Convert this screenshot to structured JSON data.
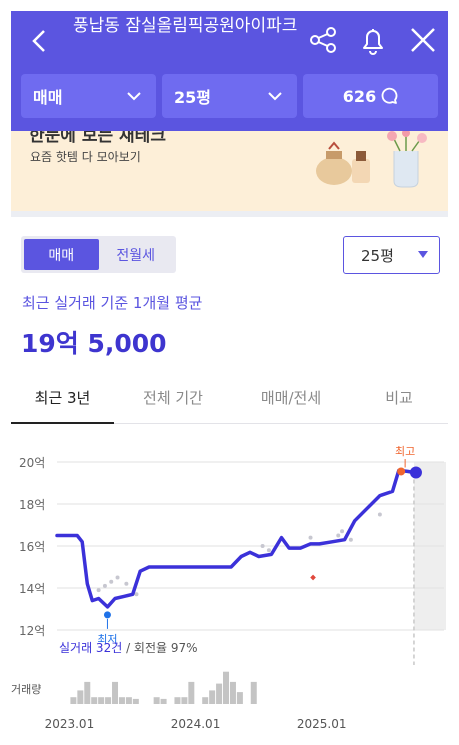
{
  "header": {
    "title": "풍납동 잠실올림픽공원아이파크",
    "filters": {
      "deal_type": "매매",
      "area": "25평",
      "comment_count": "626"
    },
    "bg_color": "#5b55e0"
  },
  "banner": {
    "headline": "한눈에 보는 재테크",
    "subtitle": "요즘 핫템 다 모아보기"
  },
  "segment": {
    "options": [
      "매매",
      "전월세"
    ],
    "selected": "매매"
  },
  "area_select": {
    "value": "25평"
  },
  "summary": {
    "label": "최근 실거래 기준 1개월 평균",
    "price": "19억 5,000"
  },
  "tabs": [
    {
      "label": "최근 3년",
      "active": true
    },
    {
      "label": "전체 기간",
      "active": false
    },
    {
      "label": "매매/전세",
      "active": false
    },
    {
      "label": "비교",
      "active": false
    }
  ],
  "chart_data": {
    "type": "line",
    "y_ticks": [
      "20억",
      "18억",
      "16억",
      "14억",
      "12억"
    ],
    "y_values": [
      20,
      18,
      16,
      14,
      12
    ],
    "ylim": [
      12,
      20
    ],
    "x_ticks": [
      "2023.01",
      "2024.01",
      "2025.01"
    ],
    "series": [
      {
        "values": [
          [
            2022.92,
            16.5
          ],
          [
            2023.0,
            16.5
          ],
          [
            2023.08,
            16.5
          ],
          [
            2023.12,
            16.2
          ],
          [
            2023.16,
            14.2
          ],
          [
            2023.2,
            13.4
          ],
          [
            2023.25,
            13.5
          ],
          [
            2023.32,
            13.1
          ],
          [
            2023.38,
            13.5
          ],
          [
            2023.45,
            13.6
          ],
          [
            2023.52,
            13.7
          ],
          [
            2023.58,
            14.8
          ],
          [
            2023.65,
            15.0
          ],
          [
            2023.8,
            15.0
          ],
          [
            2024.0,
            15.0
          ],
          [
            2024.2,
            15.0
          ],
          [
            2024.3,
            15.0
          ],
          [
            2024.38,
            15.5
          ],
          [
            2024.45,
            15.7
          ],
          [
            2024.52,
            15.5
          ],
          [
            2024.62,
            15.6
          ],
          [
            2024.7,
            16.4
          ],
          [
            2024.76,
            15.9
          ],
          [
            2024.85,
            15.9
          ],
          [
            2024.93,
            16.1
          ],
          [
            2025.0,
            16.1
          ],
          [
            2025.1,
            16.2
          ],
          [
            2025.2,
            16.3
          ],
          [
            2025.28,
            17.2
          ],
          [
            2025.38,
            17.8
          ],
          [
            2025.48,
            18.4
          ],
          [
            2025.58,
            18.6
          ],
          [
            2025.63,
            19.6
          ],
          [
            2025.7,
            19.55
          ],
          [
            2025.75,
            19.5
          ]
        ]
      }
    ],
    "scatter_points": [
      [
        2023.25,
        13.9
      ],
      [
        2023.3,
        14.1
      ],
      [
        2023.35,
        14.3
      ],
      [
        2023.4,
        14.5
      ],
      [
        2023.47,
        14.2
      ],
      [
        2023.55,
        13.7
      ],
      [
        2024.55,
        16.0
      ],
      [
        2024.6,
        15.8
      ],
      [
        2024.93,
        16.4
      ],
      [
        2025.15,
        16.5
      ],
      [
        2025.18,
        16.7
      ],
      [
        2025.25,
        16.3
      ],
      [
        2025.48,
        17.5
      ]
    ],
    "highlight_point": [
      2024.95,
      14.5
    ],
    "max_label": "최고",
    "min_label": "최저",
    "max_point": [
      2025.68,
      19.55
    ],
    "min_point": [
      2023.32,
      13.1
    ],
    "current_point": [
      2025.75,
      19.5
    ],
    "trade_summary": "실거래 32건 / 회전율 97%",
    "volume_label": "거래량",
    "volume": [
      0.2,
      0.4,
      0.65,
      0.2,
      0.2,
      0.2,
      0.65,
      0.2,
      0.2,
      0.15,
      0,
      0,
      0.2,
      0.15,
      0,
      0.2,
      0.2,
      0.65,
      0,
      0.2,
      0.4,
      0.6,
      0.95,
      0.65,
      0.35,
      0,
      0.65
    ],
    "volume_x_start": 2023.05,
    "volume_x_step": 0.055,
    "colors": {
      "line": "#3b31d9",
      "max": "#f0652e",
      "min": "#1f72e8",
      "scatter": "#c7c7d0",
      "highlight": "#e0483c",
      "future_bg": "#eeeeee"
    }
  }
}
